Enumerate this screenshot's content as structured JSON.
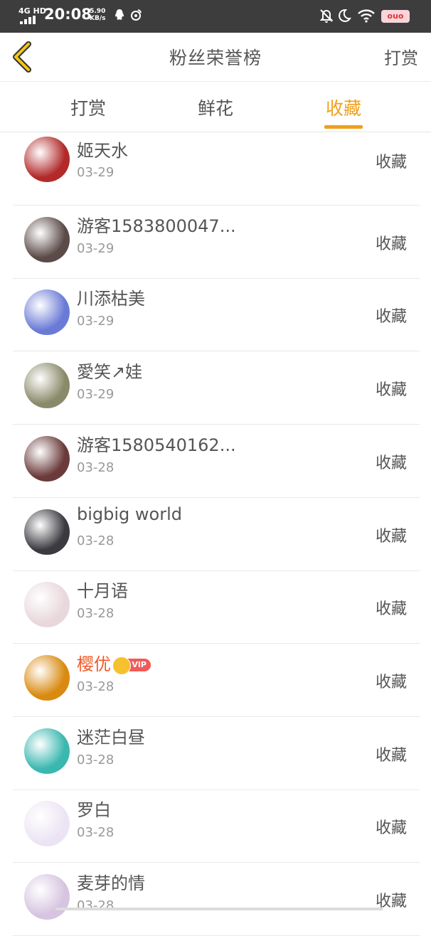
{
  "status_bar": {
    "network": "4G HD",
    "time": "20:08",
    "speed_value": "5.90",
    "speed_unit": "KB/s",
    "battery_label": "ouo"
  },
  "header": {
    "title": "粉丝荣誉榜",
    "action_label": "打赏",
    "back_icon": "chevron-left-icon"
  },
  "tabs": [
    {
      "label": "打赏",
      "active": false
    },
    {
      "label": "鲜花",
      "active": false
    },
    {
      "label": "收藏",
      "active": true
    }
  ],
  "colors": {
    "accent": "#f0a01c",
    "vip_name": "#f05a28",
    "statusbar": "#3d3d3d"
  },
  "fans": [
    {
      "name": "姬天水",
      "date": "03-29",
      "action": "收藏",
      "avatar_color": "#b22a2a",
      "vip": false
    },
    {
      "name": "游客1583800047...",
      "date": "03-29",
      "action": "收藏",
      "avatar_color": "#5a4a48",
      "vip": false
    },
    {
      "name": "川添枯美",
      "date": "03-29",
      "action": "收藏",
      "avatar_color": "#6a7bd6",
      "vip": false
    },
    {
      "name": "愛笑↗娃",
      "date": "03-29",
      "action": "收藏",
      "avatar_color": "#8a8a6a",
      "vip": false
    },
    {
      "name": "游客1580540162...",
      "date": "03-28",
      "action": "收藏",
      "avatar_color": "#6b3a3a",
      "vip": false
    },
    {
      "name": "bigbig world",
      "date": "03-28",
      "action": "收藏",
      "avatar_color": "#3a3a40",
      "vip": false
    },
    {
      "name": "十月语",
      "date": "03-28",
      "action": "收藏",
      "avatar_color": "#e8d8dc",
      "vip": false
    },
    {
      "name": "樱优",
      "date": "03-28",
      "action": "收藏",
      "avatar_color": "#d98a10",
      "vip": true,
      "vip_label": "VIP"
    },
    {
      "name": "迷茫白昼",
      "date": "03-28",
      "action": "收藏",
      "avatar_color": "#3ab7b0",
      "vip": false
    },
    {
      "name": "罗白",
      "date": "03-28",
      "action": "收藏",
      "avatar_color": "#ece4f4",
      "vip": false
    },
    {
      "name": "麦芽的情",
      "date": "03-28",
      "action": "收藏",
      "avatar_color": "#d6c4e0",
      "vip": false
    }
  ]
}
